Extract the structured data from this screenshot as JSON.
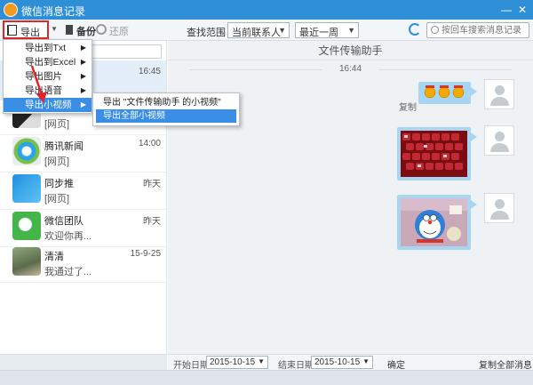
{
  "window": {
    "title": "微信消息记录",
    "minimize": "—",
    "close": "✕"
  },
  "toolbar": {
    "export_label": "导出",
    "backup_label": "备份",
    "restore_label": "还原",
    "range_label": "查找范围：",
    "contact_select": "当前联系人",
    "period_select": "最近一周",
    "search_placeholder": "按回车搜索消息记录"
  },
  "export_menu": {
    "items": [
      {
        "label": "导出到Txt"
      },
      {
        "label": "导出到Excel"
      },
      {
        "label": "导出图片"
      },
      {
        "label": "导出语音"
      },
      {
        "label": "导出小视频"
      }
    ],
    "submenu": [
      {
        "label": "导出 \"文件传输助手 的小视频\""
      },
      {
        "label": "导出全部小视频"
      }
    ]
  },
  "contacts": [
    {
      "name": "",
      "date": "16:45",
      "msg": ""
    },
    {
      "name": "",
      "date": "",
      "msg": "[网页]"
    },
    {
      "name": "腾讯新闻",
      "date": "14:00",
      "msg": "[网页]"
    },
    {
      "name": "同步推",
      "date": "昨天",
      "msg": "[网页]"
    },
    {
      "name": "微信团队",
      "date": "昨天",
      "msg": "欢迎你再..."
    },
    {
      "name": "清清",
      "date": "15-9-25",
      "msg": "我通过了..."
    }
  ],
  "chat": {
    "title": "文件传输助手",
    "time": "16:44",
    "copy_label": "复制"
  },
  "bottom": {
    "start_label": "开始日期",
    "start_date": "2015-10-15",
    "end_label": "结束日期",
    "end_date": "2015-10-15",
    "confirm": "确定",
    "copy_all": "复制全部消息"
  },
  "colors": {
    "titlebar": "#2f8fd6",
    "bubble": "#a8d6f2",
    "highlight": "#3a8ee6",
    "annotation": "#e0262b"
  }
}
